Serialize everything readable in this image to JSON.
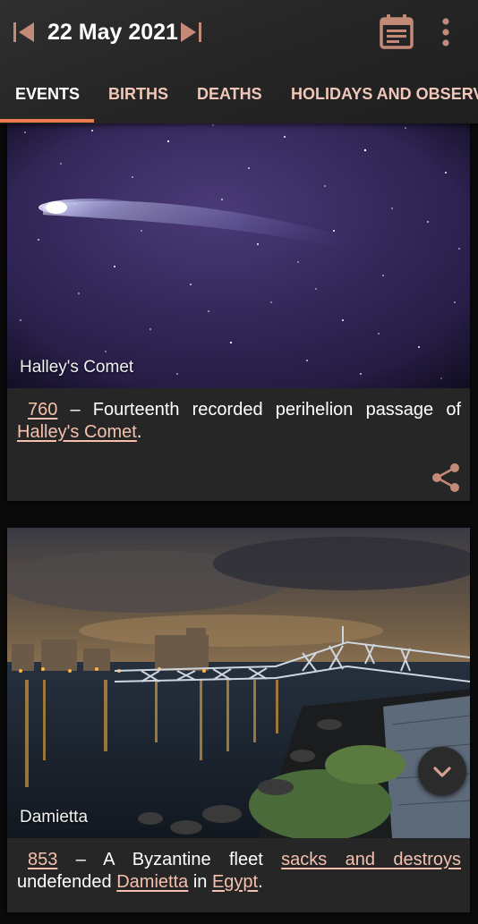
{
  "header": {
    "date": "22 May 2021",
    "prev_icon": "skip-previous-icon",
    "next_icon": "skip-next-icon",
    "calendar_icon": "calendar-icon",
    "more_icon": "more-vert-icon"
  },
  "tabs": [
    {
      "label": "EVENTS",
      "active": true
    },
    {
      "label": "BIRTHS",
      "active": false
    },
    {
      "label": "DEATHS",
      "active": false
    },
    {
      "label": "HOLIDAYS AND OBSERV",
      "active": false
    }
  ],
  "cards": [
    {
      "image_caption": "Halley's Comet",
      "year": "760",
      "text_parts": [
        " – Fourteenth recorded perihelion passage of ",
        "Halley's Comet",
        "."
      ]
    },
    {
      "image_caption": "Damietta",
      "year": "853",
      "text_parts": [
        " – A Byzantine fleet ",
        "sacks and destroys",
        " undefended ",
        "Damietta",
        " in ",
        "Egypt",
        "."
      ]
    }
  ],
  "colors": {
    "accent": "#ea7b4d",
    "link": "#f5c1ae",
    "tab_inactive": "#f0c7b8",
    "card_bg": "#262626"
  }
}
